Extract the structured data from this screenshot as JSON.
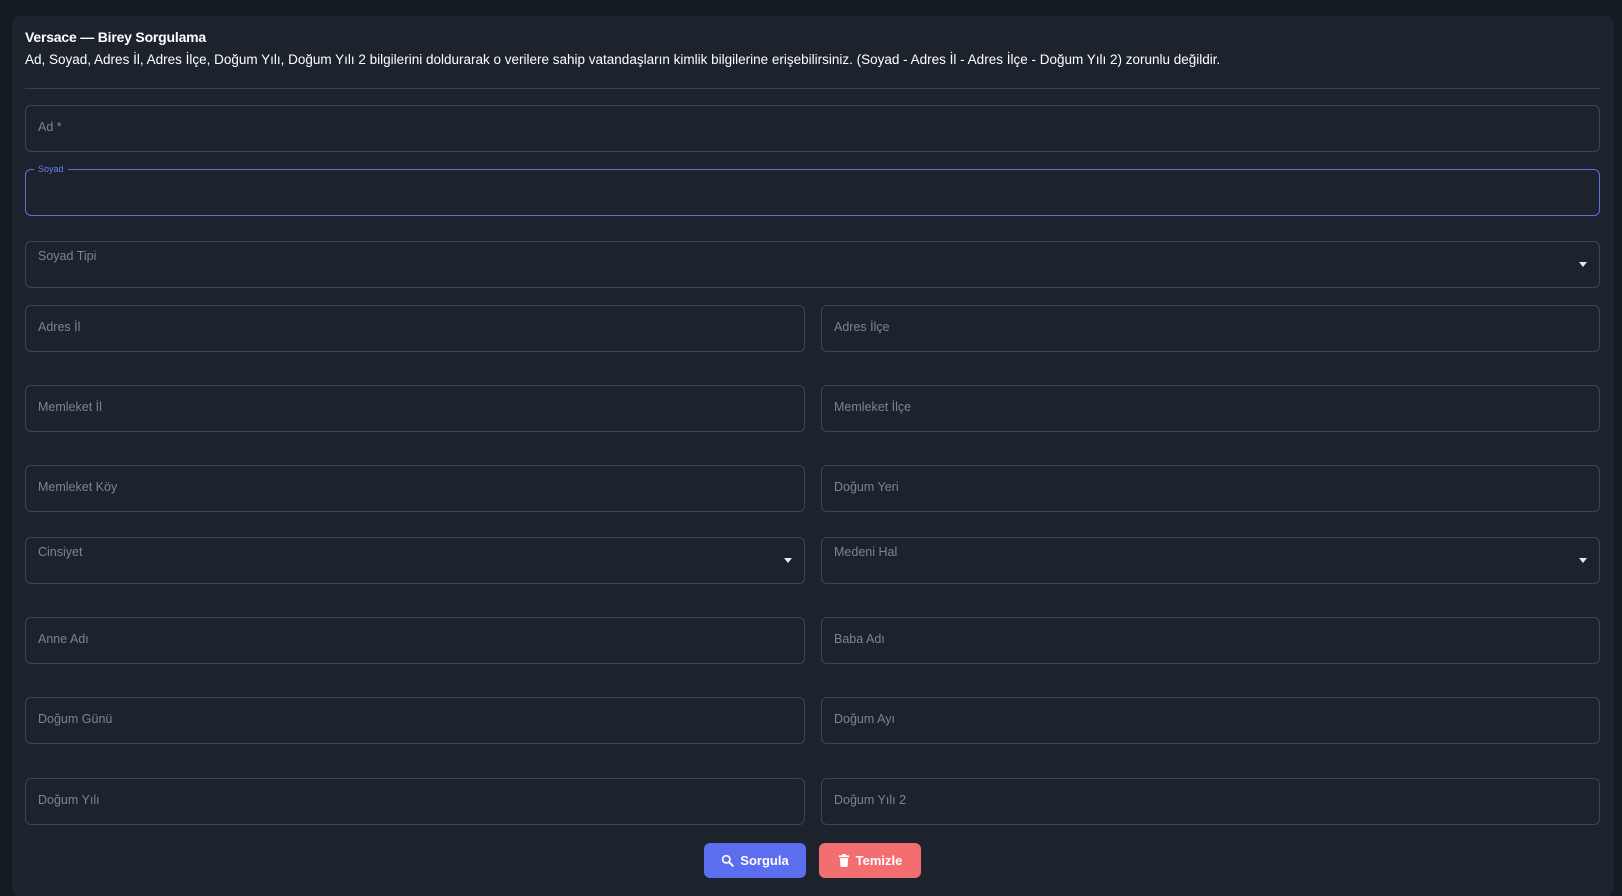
{
  "header": {
    "title": "Versace — Birey Sorgulama",
    "description": "Ad, Soyad, Adres İl, Adres İlçe, Doğum Yılı, Doğum Yılı 2 bilgilerini doldurarak o verilere sahip vatandaşların kimlik bilgilerine erişebilirsiniz. (Soyad - Adres İl - Adres İlçe - Doğum Yılı 2) zorunlu değildir."
  },
  "fields": {
    "ad": "Ad *",
    "soyad": "Soyad",
    "soyad_tipi": "Soyad Tipi",
    "adres_il": "Adres İl",
    "adres_ilce": "Adres İlçe",
    "memleket_il": "Memleket İl",
    "memleket_ilce": "Memleket İlçe",
    "memleket_koy": "Memleket Köy",
    "dogum_yeri": "Doğum Yeri",
    "cinsiyet": "Cinsiyet",
    "medeni_hal": "Medeni Hal",
    "anne_adi": "Anne Adı",
    "baba_adi": "Baba Adı",
    "dogum_gunu": "Doğum Günü",
    "dogum_ayi": "Doğum Ayı",
    "dogum_yili": "Doğum Yılı",
    "dogum_yili_2": "Doğum Yılı 2"
  },
  "buttons": {
    "search": "Sorgula",
    "clear": "Temizle"
  },
  "colors": {
    "accent": "#5b6ef0",
    "danger": "#f26e70",
    "focus_border": "#5b6fe0"
  },
  "icons": {
    "search": "search-icon",
    "clear": "trash-icon"
  }
}
